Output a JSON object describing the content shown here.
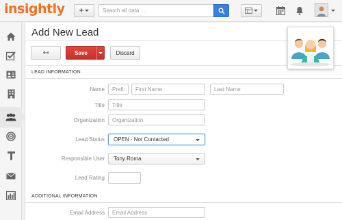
{
  "app": {
    "logo": "insightly"
  },
  "topbar": {
    "add_label": "+",
    "search_placeholder": "Search all data....",
    "search_value": ""
  },
  "sidebar": {
    "items": [
      {
        "icon": "home-icon"
      },
      {
        "icon": "tasks-icon"
      },
      {
        "icon": "contacts-icon"
      },
      {
        "icon": "organizations-icon"
      },
      {
        "icon": "leads-icon",
        "active": true
      },
      {
        "icon": "opportunities-icon"
      },
      {
        "icon": "projects-icon"
      },
      {
        "icon": "email-icon"
      },
      {
        "icon": "reports-icon"
      }
    ]
  },
  "page": {
    "title": "Add New Lead"
  },
  "toolbar": {
    "back_label": "↤",
    "save_label": "Save",
    "discard_label": "Discard"
  },
  "lead_info": {
    "heading": "LEAD INFORMATION",
    "name_label": "Name",
    "prefix_placeholder": "Prefix",
    "first_name_placeholder": "First Name",
    "last_name_placeholder": "Last Name",
    "title_label": "Title",
    "title_placeholder": "Title",
    "organization_label": "Organization",
    "organization_placeholder": "Organization",
    "lead_status_label": "Lead Status",
    "lead_status_value": "OPEN - Not Contacted",
    "responsible_user_label": "Responsible User",
    "responsible_user_value": "Tony Roma",
    "lead_rating_label": "Lead Rating",
    "lead_rating_value": ""
  },
  "additional_info": {
    "heading": "ADDITIONAL INFORMATION",
    "email_label": "Email Address",
    "email_placeholder": "Email Address"
  },
  "colors": {
    "brand": "#f37021",
    "save": "#d9403a",
    "search_button": "#3a7fe0"
  }
}
